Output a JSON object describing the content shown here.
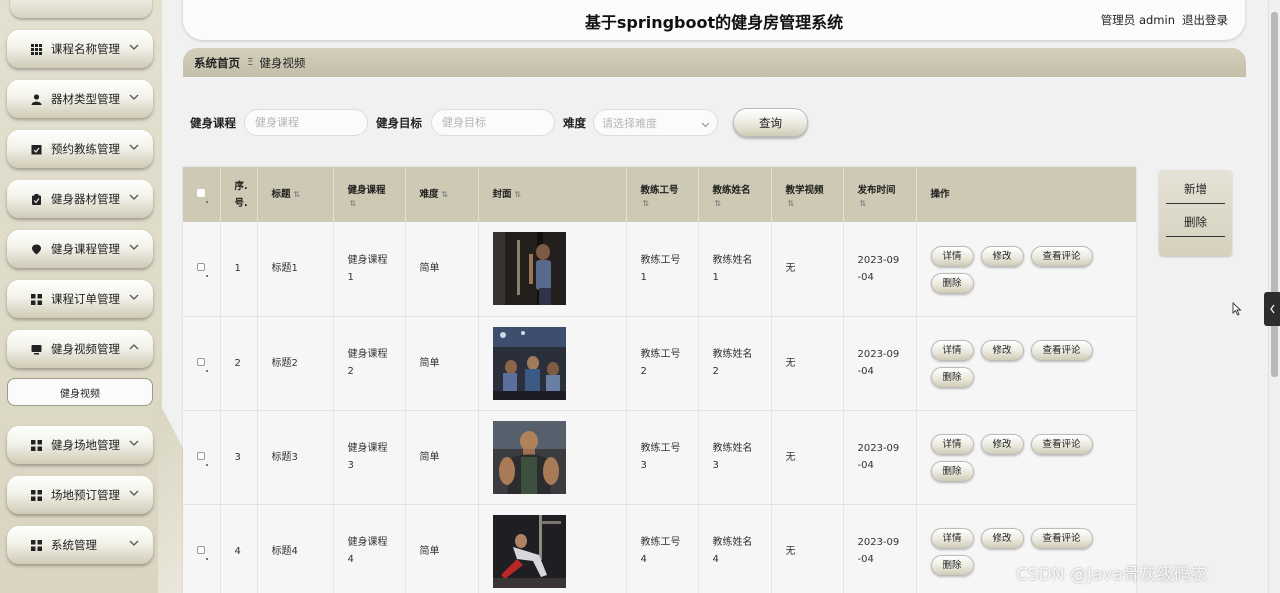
{
  "header": {
    "title": "基于springboot的健身房管理系统",
    "user_label": "管理员 admin",
    "logout": "退出登录"
  },
  "sidebar": {
    "items": [
      {
        "label": "课程名称管理",
        "icon": "grid-icon",
        "expanded": false
      },
      {
        "label": "器材类型管理",
        "icon": "user-icon",
        "expanded": false
      },
      {
        "label": "预约教练管理",
        "icon": "calendar-check-icon",
        "expanded": false
      },
      {
        "label": "健身器材管理",
        "icon": "clipboard-icon",
        "expanded": false
      },
      {
        "label": "健身课程管理",
        "icon": "location-pin-icon",
        "expanded": false
      },
      {
        "label": "课程订单管理",
        "icon": "grid-icon",
        "expanded": false
      },
      {
        "label": "健身视频管理",
        "icon": "monitor-icon",
        "expanded": true
      },
      {
        "label": "健身场地管理",
        "icon": "grid-icon",
        "expanded": false
      },
      {
        "label": "场地预订管理",
        "icon": "grid-icon",
        "expanded": false
      },
      {
        "label": "系统管理",
        "icon": "grid-icon",
        "expanded": false
      }
    ],
    "submenu": {
      "label": "健身视频"
    }
  },
  "breadcrumb": {
    "home": "系统首页",
    "separator": "Ξ",
    "current": "健身视频"
  },
  "search": {
    "course_label": "健身课程",
    "course_placeholder": "健身课程",
    "goal_label": "健身目标",
    "goal_placeholder": "健身目标",
    "difficulty_label": "难度",
    "difficulty_placeholder": "请选择难度",
    "query_button": "查询"
  },
  "actions": {
    "add": "新增",
    "delete": "删除"
  },
  "table": {
    "columns": {
      "index": "序号.",
      "title": "标题",
      "course": "健身课程",
      "difficulty": "难度",
      "cover": "封面",
      "coach_id": "教练工号",
      "coach_name": "教练姓名",
      "video": "教学视频",
      "publish_time": "发布时间",
      "operations": "操作"
    },
    "index_header_lines": [
      "序.",
      "号."
    ],
    "rows": [
      {
        "index": "1",
        "title": "标题1",
        "course": "健身课程1",
        "course_l1": "健身课程",
        "course_l2": "1",
        "difficulty": "简单",
        "coach_id_l1": "教练工号",
        "coach_id_l2": "1",
        "coach_name_l1": "教练姓名",
        "coach_name_l2": "1",
        "video": "无",
        "time_l1": "2023-09",
        "time_l2": "-04",
        "cover_scene": "gym-rope"
      },
      {
        "index": "2",
        "title": "标题2",
        "course": "健身课程2",
        "course_l1": "健身课程",
        "course_l2": "2",
        "difficulty": "简单",
        "coach_id_l1": "教练工号",
        "coach_id_l2": "2",
        "coach_name_l1": "教练姓名",
        "coach_name_l2": "2",
        "video": "无",
        "time_l1": "2023-09",
        "time_l2": "-04",
        "cover_scene": "gym-class"
      },
      {
        "index": "3",
        "title": "标题3",
        "course": "健身课程3",
        "course_l1": "健身课程",
        "course_l2": "3",
        "difficulty": "简单",
        "coach_id_l1": "教练工号",
        "coach_id_l2": "3",
        "coach_name_l1": "教练姓名",
        "coach_name_l2": "3",
        "video": "无",
        "time_l1": "2023-09",
        "time_l2": "-04",
        "cover_scene": "bodybuilder"
      },
      {
        "index": "4",
        "title": "标题4",
        "course": "健身课程4",
        "course_l1": "健身课程",
        "course_l2": "4",
        "difficulty": "简单",
        "coach_id_l1": "教练工号",
        "coach_id_l2": "4",
        "coach_name_l1": "教练姓名",
        "coach_name_l2": "4",
        "video": "无",
        "time_l1": "2023-09",
        "time_l2": "-04",
        "cover_scene": "floor-exercise"
      }
    ],
    "row_buttons": {
      "detail": "详情",
      "edit": "修改",
      "comments": "查看评论",
      "delete": "删除"
    }
  },
  "watermark": "CSDN @Java骨灰级码农"
}
